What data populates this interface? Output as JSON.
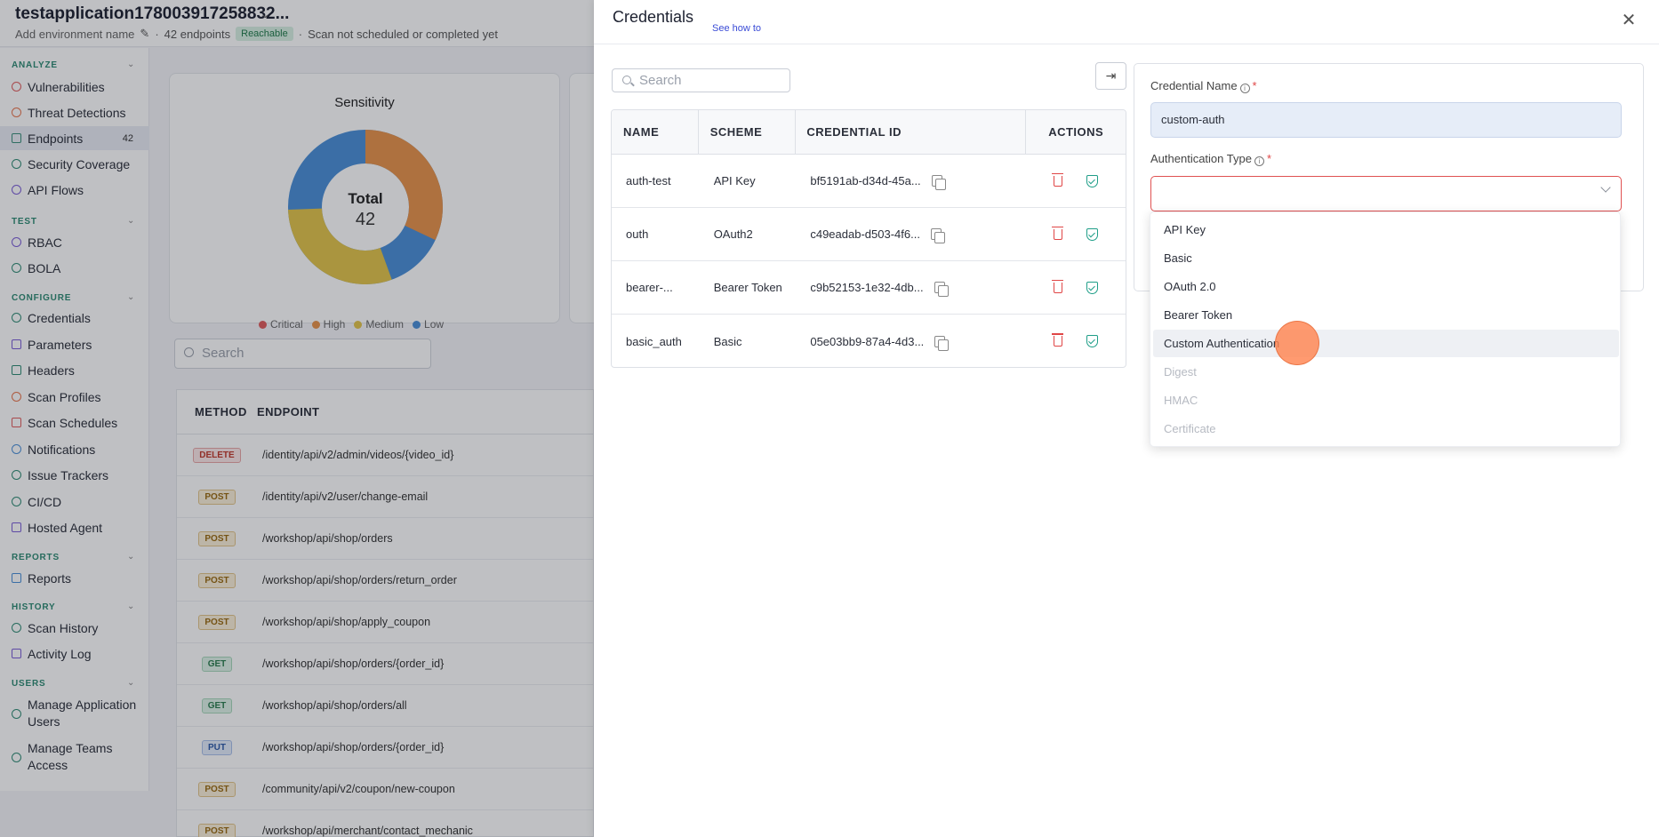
{
  "app": {
    "title": "testapplication178003917258832...",
    "env_placeholder": "Add environment name",
    "endpoints_count": "42 endpoints",
    "reachable": "Reachable",
    "scan_status": "Scan not scheduled or completed yet"
  },
  "sidebar": {
    "sections": [
      {
        "label": "ANALYZE",
        "items": [
          {
            "label": "Vulnerabilities",
            "icon": "vulnerabilities-icon"
          },
          {
            "label": "Threat Detections",
            "icon": "threat-icon"
          },
          {
            "label": "Endpoints",
            "icon": "endpoints-icon",
            "count": "42",
            "active": true
          },
          {
            "label": "Security Coverage",
            "icon": "coverage-icon"
          },
          {
            "label": "API Flows",
            "icon": "flows-icon"
          }
        ]
      },
      {
        "label": "TEST",
        "items": [
          {
            "label": "RBAC",
            "icon": "rbac-icon"
          },
          {
            "label": "BOLA",
            "icon": "bola-icon"
          }
        ]
      },
      {
        "label": "CONFIGURE",
        "items": [
          {
            "label": "Credentials",
            "icon": "key-icon"
          },
          {
            "label": "Parameters",
            "icon": "braces-icon"
          },
          {
            "label": "Headers",
            "icon": "headers-icon"
          },
          {
            "label": "Scan Profiles",
            "icon": "profiles-icon"
          },
          {
            "label": "Scan Schedules",
            "icon": "calendar-icon"
          },
          {
            "label": "Notifications",
            "icon": "bell-icon"
          },
          {
            "label": "Issue Trackers",
            "icon": "tracker-icon"
          },
          {
            "label": "CI/CD",
            "icon": "cicd-icon"
          },
          {
            "label": "Hosted Agent",
            "icon": "agent-icon"
          }
        ]
      },
      {
        "label": "REPORTS",
        "items": [
          {
            "label": "Reports",
            "icon": "report-icon"
          }
        ]
      },
      {
        "label": "HISTORY",
        "items": [
          {
            "label": "Scan History",
            "icon": "history-icon"
          },
          {
            "label": "Activity Log",
            "icon": "log-icon"
          }
        ]
      },
      {
        "label": "USERS",
        "items": [
          {
            "label": "Manage Application Users",
            "icon": "users-icon"
          },
          {
            "label": "Manage Teams Access",
            "icon": "teams-icon"
          }
        ]
      }
    ]
  },
  "sensitivity": {
    "title": "Sensitivity",
    "total_label": "Total",
    "total_value": "42",
    "legend": [
      {
        "label": "Critical",
        "color": "#e05c5c"
      },
      {
        "label": "High",
        "color": "#e8934a"
      },
      {
        "label": "Medium",
        "color": "#e3c44a"
      },
      {
        "label": "Low",
        "color": "#4a8fd8"
      }
    ]
  },
  "endpoints": {
    "search_placeholder": "Search",
    "headers": {
      "method": "METHOD",
      "endpoint": "ENDPOINT"
    },
    "rows": [
      {
        "method": "DELETE",
        "path": "/identity/api/v2/admin/videos/{video_id}"
      },
      {
        "method": "POST",
        "path": "/identity/api/v2/user/change-email"
      },
      {
        "method": "POST",
        "path": "/workshop/api/shop/orders"
      },
      {
        "method": "POST",
        "path": "/workshop/api/shop/orders/return_order"
      },
      {
        "method": "POST",
        "path": "/workshop/api/shop/apply_coupon"
      },
      {
        "method": "GET",
        "path": "/workshop/api/shop/orders/{order_id}"
      },
      {
        "method": "GET",
        "path": "/workshop/api/shop/orders/all"
      },
      {
        "method": "PUT",
        "path": "/workshop/api/shop/orders/{order_id}"
      },
      {
        "method": "POST",
        "path": "/community/api/v2/coupon/new-coupon"
      },
      {
        "method": "POST",
        "path": "/workshop/api/merchant/contact_mechanic"
      }
    ]
  },
  "drawer": {
    "title": "Credentials",
    "see_how": "See how to",
    "search_placeholder": "Search",
    "table": {
      "headers": {
        "name": "NAME",
        "scheme": "SCHEME",
        "credential_id": "CREDENTIAL ID",
        "actions": "ACTIONS"
      },
      "rows": [
        {
          "name": "auth-test",
          "scheme": "API Key",
          "id": "bf5191ab-d34d-45a..."
        },
        {
          "name": "outh",
          "scheme": "OAuth2",
          "id": "c49eadab-d503-4f6..."
        },
        {
          "name": "bearer-...",
          "scheme": "Bearer Token",
          "id": "c9b52153-1e32-4db..."
        },
        {
          "name": "basic_auth",
          "scheme": "Basic",
          "id": "05e03bb9-87a4-4d3..."
        }
      ]
    },
    "form": {
      "name_label": "Credential Name",
      "name_value": "custom-auth",
      "type_label": "Authentication Type",
      "required_mark": "*",
      "options": [
        {
          "label": "API Key",
          "disabled": false
        },
        {
          "label": "Basic",
          "disabled": false
        },
        {
          "label": "OAuth 2.0",
          "disabled": false
        },
        {
          "label": "Bearer Token",
          "disabled": false
        },
        {
          "label": "Custom Authentication",
          "disabled": false,
          "highlighted": true
        },
        {
          "label": "Digest",
          "disabled": true
        },
        {
          "label": "HMAC",
          "disabled": true
        },
        {
          "label": "Certificate",
          "disabled": true
        }
      ]
    }
  }
}
